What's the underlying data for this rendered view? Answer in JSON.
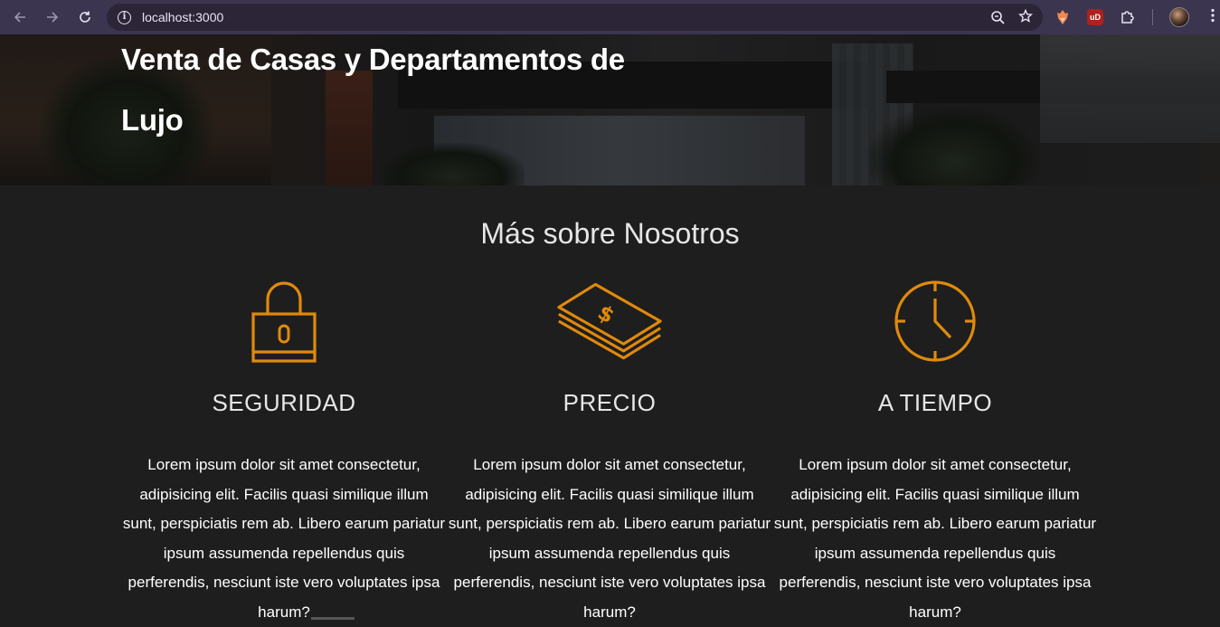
{
  "browser": {
    "url": "localhost:3000",
    "back_icon": "arrow-left-icon",
    "forward_icon": "arrow-right-icon",
    "reload_icon": "reload-icon",
    "info_glyph": "i",
    "zoom_icon": "zoom-icon",
    "bookmark_icon": "star-icon",
    "extensions": [
      "fox-extension-icon",
      "ublock-icon",
      "puzzle-icon"
    ],
    "ublock_label": "uD"
  },
  "hero": {
    "title": "Venta de Casas y Departamentos de Lujo"
  },
  "about": {
    "title": "Más sobre Nosotros",
    "cards": [
      {
        "icon": "lock-icon",
        "title": "SEGURIDAD",
        "text": "Lorem ipsum dolor sit amet consectetur, adipisicing elit. Facilis quasi similique illum sunt, perspiciatis rem ab. Libero earum pariatur ipsum assumenda repellendus quis perferendis, nesciunt iste vero voluptates ipsa harum?"
      },
      {
        "icon": "money-stack-icon",
        "title": "PRECIO",
        "text": "Lorem ipsum dolor sit amet consectetur, adipisicing elit. Facilis quasi similique illum sunt, perspiciatis rem ab. Libero earum pariatur ipsum assumenda repellendus quis perferendis, nesciunt iste vero voluptates ipsa harum?"
      },
      {
        "icon": "clock-icon",
        "title": "A TIEMPO",
        "text": "Lorem ipsum dolor sit amet consectetur, adipisicing elit. Facilis quasi similique illum sunt, perspiciatis rem ab. Libero earum pariatur ipsum assumenda repellendus quis perferendis, nesciunt iste vero voluptates ipsa harum?"
      }
    ]
  },
  "colors": {
    "accent": "#e08a0c",
    "background": "#1e1e1e",
    "chrome": "#3c3550"
  }
}
